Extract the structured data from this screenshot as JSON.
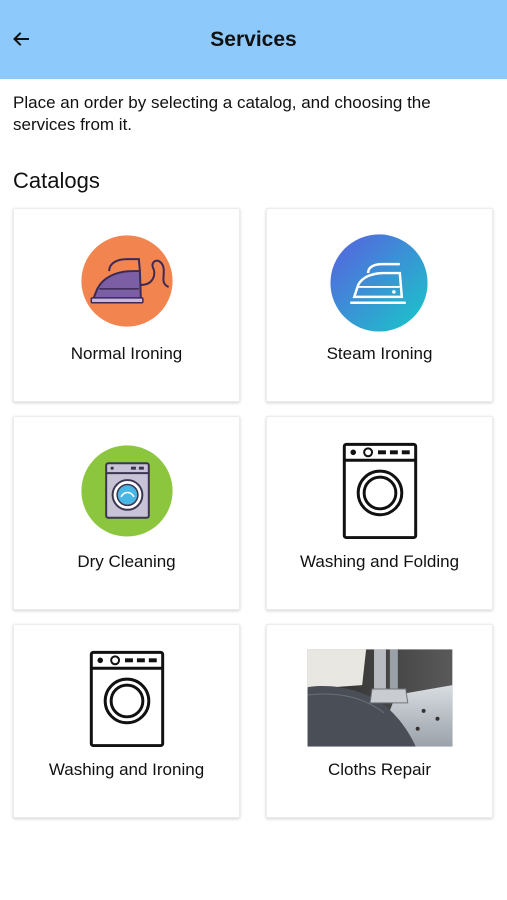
{
  "header": {
    "title": "Services",
    "back_icon": "back-arrow-icon",
    "background_color": "#8ec9fb"
  },
  "intro": "Place an order by selecting a catalog, and choosing the services from it.",
  "catalogs_heading": "Catalogs",
  "catalogs": [
    {
      "label": "Normal Ironing",
      "icon": "iron-icon",
      "icon_color": "#f2854f"
    },
    {
      "label": "Steam Ironing",
      "icon": "steam-iron-icon",
      "icon_color": "#3aa3e0"
    },
    {
      "label": "Dry Cleaning",
      "icon": "dry-cleaning-machine-icon",
      "icon_color": "#8cc63f"
    },
    {
      "label": "Washing and Folding",
      "icon": "washing-machine-icon"
    },
    {
      "label": "Washing and Ironing",
      "icon": "washing-machine-icon"
    },
    {
      "label": "Cloths Repair",
      "icon": "sewing-machine-photo"
    }
  ]
}
